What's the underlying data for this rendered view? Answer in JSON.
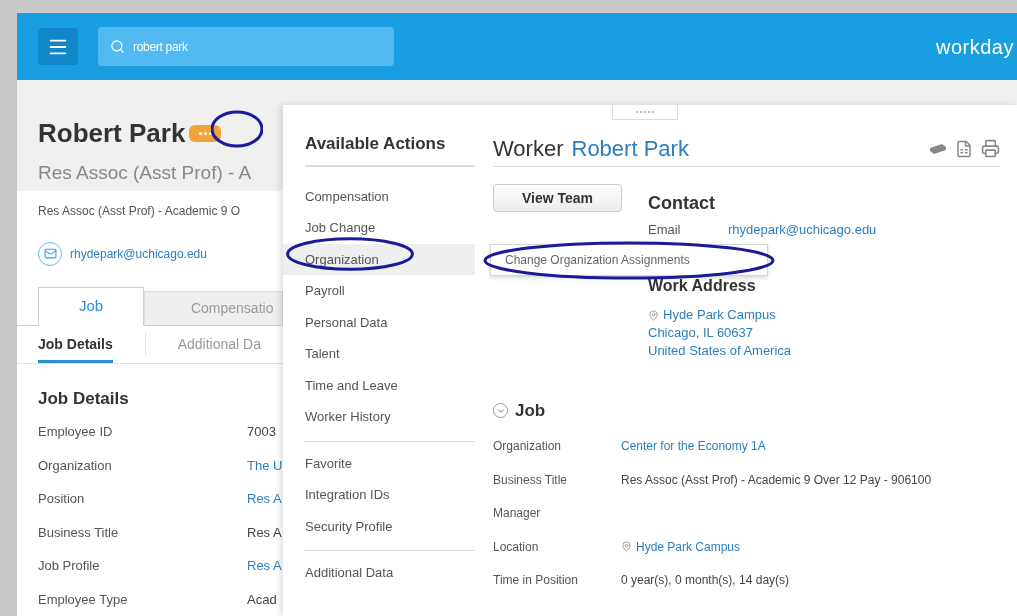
{
  "header": {
    "search": {
      "value": "robert park"
    },
    "logo": "workday"
  },
  "worker": {
    "name": "Robert Park",
    "subtitle": "Res Assoc (Asst Prof) - A",
    "position_line": "Res Assoc (Asst Prof) - Academic 9 O",
    "email": "rhydepark@uchicago.edu"
  },
  "tabs": [
    {
      "label": "Job",
      "selected": true
    },
    {
      "label": "Compensatio",
      "selected": false
    }
  ],
  "subtabs": [
    {
      "label": "Job Details",
      "selected": true
    },
    {
      "label": "Additional Da",
      "selected": false
    }
  ],
  "job_details": {
    "title": "Job Details",
    "rows": [
      {
        "label": "Employee ID",
        "value": "7003",
        "kind": "text"
      },
      {
        "label": "Organization",
        "value": "The U",
        "kind": "link"
      },
      {
        "label": "Position",
        "value": "Res A",
        "kind": "link"
      },
      {
        "label": "Business Title",
        "value": "Res A",
        "kind": "text"
      },
      {
        "label": "Job Profile",
        "value": "Res A",
        "kind": "link"
      },
      {
        "label": "Employee Type",
        "value": "Acad",
        "kind": "text"
      }
    ]
  },
  "actions_panel": {
    "title": "Available Actions",
    "groups": [
      [
        {
          "label": "Compensation",
          "selected": false
        },
        {
          "label": "Job Change",
          "selected": false
        },
        {
          "label": "Organization",
          "selected": true
        },
        {
          "label": "Payroll",
          "selected": false
        },
        {
          "label": "Personal Data",
          "selected": false
        },
        {
          "label": "Talent",
          "selected": false
        },
        {
          "label": "Time and Leave",
          "selected": false
        },
        {
          "label": "Worker History",
          "selected": false
        }
      ],
      [
        {
          "label": "Favorite",
          "selected": false
        },
        {
          "label": "Integration IDs",
          "selected": false
        },
        {
          "label": "Security Profile",
          "selected": false
        }
      ],
      [
        {
          "label": "Additional Data",
          "selected": false
        }
      ]
    ]
  },
  "worker_panel": {
    "label": "Worker",
    "name": "Robert Park",
    "button": "View Team",
    "contact": {
      "title": "Contact",
      "email_label": "Email",
      "email": "rhydepark@uchicago.edu"
    },
    "work_address": {
      "title": "Work Address",
      "lines": [
        "Hyde Park Campus",
        "Chicago, IL 60637",
        "United States of America"
      ]
    },
    "job": {
      "title": "Job",
      "expanded": true,
      "rows": [
        {
          "label": "Organization",
          "value": "Center for the Economy 1A",
          "kind": "link"
        },
        {
          "label": "Business Title",
          "value": "Res Assoc (Asst Prof) - Academic 9 Over 12 Pay - 906100",
          "kind": "text"
        },
        {
          "label": "Manager",
          "kind": "empty"
        },
        {
          "label": "Location",
          "value": "Hyde Park Campus",
          "kind": "location"
        },
        {
          "label": "Time in Position",
          "value": "0 year(s), 0 month(s), 14 day(s)",
          "kind": "text"
        }
      ]
    }
  },
  "flyout": {
    "items": [
      "Change Organization Assignments"
    ]
  }
}
